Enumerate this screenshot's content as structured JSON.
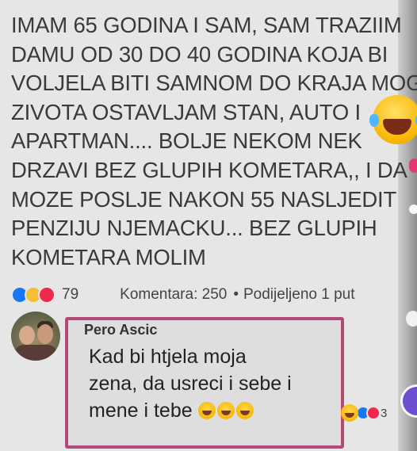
{
  "post": {
    "lines": [
      "IMAM 65 GODINA I SAM, SAM TRAZIIM",
      "DAMU OD 30 DO 40 GODINA KOJA BI",
      "VOLJELA BITI SAMNOM DO KRAJA MOG",
      "ZIVOTA OSTAVLJAM STAN, AUTO I",
      "APARTMAN.... BOLJE NEKOM NEK",
      "DRZAVI BEZ GLUPIH KOMETARA,, I DA",
      "MOZE POSLJE NAKON 55 NASLJEDIT",
      "PENZIJU NJEMACKU... BEZ GLUPIH",
      "KOMETARA MOLIM"
    ]
  },
  "reactions": {
    "count": "79",
    "comments": "Komentara: 250",
    "separator": "•",
    "shares": "Podijeljeno 1 put"
  },
  "comment": {
    "author": "Pero Ascic",
    "lines": [
      "Kad bi htjela moja",
      "zena, da usreci i sebe i",
      "mene i tebe"
    ],
    "reaction_count": "3"
  },
  "colors": {
    "highlight_border": "#b24b78",
    "like": "#1877f2",
    "love": "#f0284a",
    "haha": "#f2c037"
  },
  "icons": [
    "like-icon",
    "haha-icon",
    "love-icon",
    "laughing-crying-emoji-icon"
  ]
}
